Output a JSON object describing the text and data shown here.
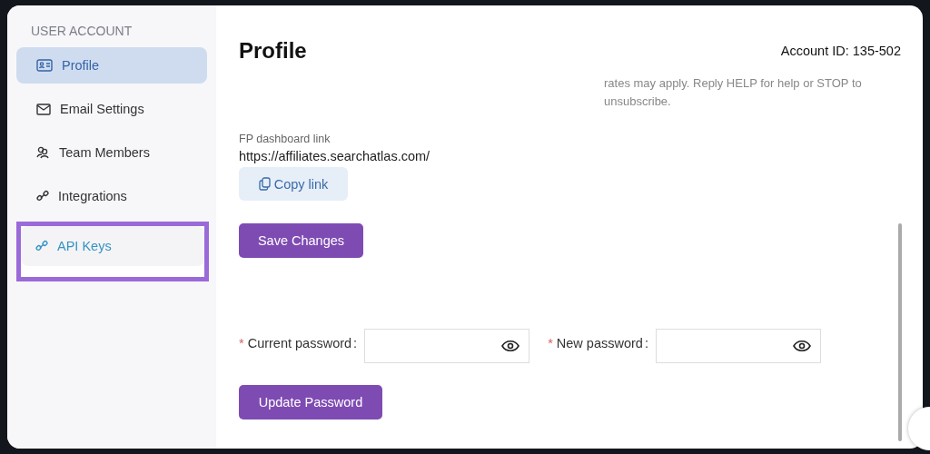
{
  "sidebar": {
    "heading": "USER ACCOUNT",
    "items": [
      {
        "label": "Profile",
        "kind": "profile",
        "selected": true,
        "highlighted": false
      },
      {
        "label": "Email Settings",
        "kind": "email",
        "selected": false,
        "highlighted": false
      },
      {
        "label": "Team Members",
        "kind": "team",
        "selected": false,
        "highlighted": false
      },
      {
        "label": "Integrations",
        "kind": "integration",
        "selected": false,
        "highlighted": false
      },
      {
        "label": "API Keys",
        "kind": "integration",
        "selected": false,
        "highlighted": true
      }
    ]
  },
  "page": {
    "title": "Profile",
    "account_id": "Account ID: 135-502",
    "notice_lines": [
      "rates may apply. Reply HELP for help or STOP to",
      "unsubscribe."
    ],
    "fp_link": {
      "label": "FP dashboard link",
      "url": "https://affiliates.searchatlas.com/",
      "copy_button": "Copy link"
    },
    "save_button": "Save Changes",
    "password_fields": [
      {
        "mark": "*",
        "label": "Current password",
        "colon": ":"
      },
      {
        "mark": "*",
        "label": "New password",
        "colon": ":"
      }
    ],
    "update_button": "Update Password"
  }
}
